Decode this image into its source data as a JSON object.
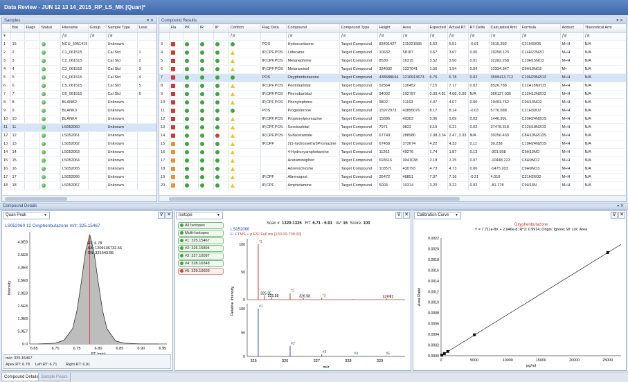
{
  "window": {
    "title": "Data Review - JUN 12 13 14_2015_RP_LS_MK [Quan]*"
  },
  "samples": {
    "title": "Samples",
    "columns": [
      "Bat",
      "Flags",
      "Status",
      "Filename",
      "Group",
      "Sample Type",
      "Leve"
    ],
    "rows": [
      {
        "n": "1",
        "bat": "15",
        "file": "NCU_5051415",
        "group": "",
        "type": "Unknown",
        "level": ""
      },
      {
        "n": "2",
        "bat": "2",
        "file": "C1_061515",
        "group": "",
        "type": "Cal Std",
        "level": "1"
      },
      {
        "n": "3",
        "bat": "3",
        "file": "C2_061515",
        "group": "",
        "type": "Cal Std",
        "level": "2"
      },
      {
        "n": "4",
        "bat": "4",
        "file": "C3_061515",
        "group": "",
        "type": "Cal Std",
        "level": "3"
      },
      {
        "n": "5",
        "bat": "5",
        "file": "C4_061515",
        "group": "",
        "type": "Cal Std",
        "level": "4"
      },
      {
        "n": "6",
        "bat": "6",
        "file": "C5_061515",
        "group": "",
        "type": "Cal Std",
        "level": "5"
      },
      {
        "n": "7",
        "bat": "7",
        "file": "C6_061515",
        "group": "",
        "type": "Cal Std",
        "level": "6"
      },
      {
        "n": "8",
        "bat": "8",
        "file": "BLANK2",
        "group": "",
        "type": "Unknown",
        "level": ""
      },
      {
        "n": "9",
        "bat": "9",
        "file": "BLANK3",
        "group": "",
        "type": "Unknown",
        "level": ""
      },
      {
        "n": "10",
        "bat": "10",
        "file": "BLANK4",
        "group": "",
        "type": "Unknown",
        "level": ""
      },
      {
        "n": "11",
        "bat": "11",
        "file": "LS052060",
        "group": "",
        "type": "Unknown",
        "level": ""
      },
      {
        "n": "12",
        "bat": "12",
        "file": "LS052061",
        "group": "",
        "type": "Unknown",
        "level": ""
      },
      {
        "n": "13",
        "bat": "13",
        "file": "LS052062",
        "group": "",
        "type": "Unknown",
        "level": ""
      },
      {
        "n": "14",
        "bat": "14",
        "file": "LS052063",
        "group": "",
        "type": "Unknown",
        "level": ""
      },
      {
        "n": "15",
        "bat": "15",
        "file": "LS052064",
        "group": "",
        "type": "Unknown",
        "level": ""
      },
      {
        "n": "16",
        "bat": "16",
        "file": "LS052065",
        "group": "",
        "type": "Unknown",
        "level": ""
      },
      {
        "n": "17",
        "bat": "17",
        "file": "LS052066",
        "group": "",
        "type": "Unknown",
        "level": ""
      },
      {
        "n": "18",
        "bat": "18",
        "file": "LS052067",
        "group": "",
        "type": "Unknown",
        "level": ""
      }
    ]
  },
  "compounds": {
    "title": "Compound Results",
    "columns": [
      "Fla",
      "PK",
      "IR",
      "IP",
      "Confirm",
      "Flag Deta",
      "Compound",
      "Compound Type",
      "Height",
      "Area",
      "Expected",
      "Actual RT",
      "RT Delta",
      "Calculated Amt",
      "Formula",
      "Adduct",
      "Theoretical Amt"
    ],
    "rows": [
      {
        "n": "3",
        "sq": "#d9342b",
        "ir": "#3aa53a",
        "conf": "dot",
        "det": "POS",
        "name": "Hydrocortisone",
        "type": "Target Compound",
        "h": "83401427",
        "a": "211021586",
        "e": "5.52",
        "rt": "5.51",
        "d": "-0.01",
        "amt": "1615.392",
        "f": "C21H30O5",
        "ad": "M+H",
        "th": "N/A"
      },
      {
        "n": "4",
        "sq": "#d9342b",
        "ir": "#3aa53a",
        "conf": "tri",
        "det": "IP,CPF,POS",
        "name": "Lidocaine",
        "type": "Target Compound",
        "h": "10632",
        "a": "58187",
        "e": "3.67",
        "rt": "3.67",
        "d": "0.00",
        "amt": "19258.123",
        "f": "C14H22N2O",
        "ad": "M+H",
        "th": "N/A"
      },
      {
        "n": "5",
        "sq": "#d9342b",
        "ir": "#3aa53a",
        "conf": "tri",
        "det": "IP,CPF,POS",
        "name": "Metanephrine",
        "type": "Target Compound",
        "h": "8530",
        "a": "16315",
        "e": "3.52",
        "rt": "3.50",
        "d": "0.01",
        "amt": "32282.268",
        "f": "C10H15NO3",
        "ad": "M+H",
        "th": "N/A"
      },
      {
        "n": "6",
        "sq": "#d9342b",
        "ir": "#3aa53a",
        "conf": "tri",
        "det": "IP,CPF,POS",
        "name": "Metaraminol",
        "type": "Target Compound",
        "h": "324032",
        "a": "1337041",
        "e": "1.50",
        "rt": "1.54",
        "d": "0.04",
        "amt": "12334.947",
        "f": "C9H13NO2",
        "ad": "M+",
        "th": "N/A"
      },
      {
        "n": "7",
        "sq": "#d9342b",
        "ir": "#3aa53a",
        "conf": "dot",
        "det": "POS",
        "name": "Oxyphenbutazone",
        "type": "Target Compound",
        "h": "438688644",
        "a": "1210913673",
        "e": "6.76",
        "rt": "6.78",
        "d": "0.02",
        "amt": "3599413.712",
        "f": "C19H20N2O3",
        "ad": "M+H",
        "th": "N/A",
        "sel": true
      },
      {
        "n": "8",
        "sq": "#d9342b",
        "ir": "#3aa53a",
        "conf": "tri",
        "det": "IP,CPF,POS",
        "name": "Pentobarbital",
        "type": "Target Compound",
        "h": "52564",
        "a": "130452",
        "e": "7.15",
        "rt": "7.17",
        "d": "0.02",
        "amt": "8526.788",
        "f": "C11H18N2O3",
        "ad": "M+H",
        "th": "N/A"
      },
      {
        "n": "9",
        "sq": "#d9342b",
        "ir": "#3aa53a",
        "conf": "tri",
        "det": "IP,CPF,POS",
        "name": "Phenobarbital",
        "type": "Target Compound",
        "h": "94002",
        "a": "292787",
        "e": "0.00,4.81",
        "rt": "4.68, 0.00",
        "d": "N/A",
        "amt": "366127.035",
        "f": "C12H12N2O3",
        "ad": "M+H",
        "th": "N/A"
      },
      {
        "n": "10",
        "sq": "#d9342b",
        "ir": "#3aa53a",
        "conf": "tri",
        "det": "IP,CPF,POS",
        "name": "Phenylephrine",
        "type": "Target Compound",
        "h": "9802",
        "a": "21163",
        "e": "4.07",
        "rt": "4.07",
        "d": "0.00",
        "amt": "19493.762",
        "f": "C9H13NO2",
        "ad": "M+H",
        "th": "N/A"
      },
      {
        "n": "11",
        "sq": "#d9342b",
        "ir": "#3aa53a",
        "conf": "dot",
        "det": "POS",
        "name": "Progesterone",
        "type": "Target Compound",
        "h": "15972973",
        "a": "43895076",
        "e": "8.17",
        "rt": "8.14",
        "d": "-0.03",
        "amt": "5776.688",
        "f": "C21H30O2",
        "ad": "M+H",
        "th": "N/A"
      },
      {
        "n": "12",
        "sq": "#d9342b",
        "ir": "#3aa53a",
        "conf": "tri",
        "det": "IP,CPF,POS",
        "name": "Propionylpromazine",
        "type": "Target Compound",
        "h": "15686",
        "a": "40303",
        "e": "5.06",
        "rt": "5.09",
        "d": "0.03",
        "amt": "1446.991",
        "f": "C20H24N2OS",
        "ad": "M+H",
        "th": "N/A"
      },
      {
        "n": "13",
        "sq": "#d9342b",
        "ir": "#3aa53a",
        "conf": "tri",
        "det": "IP,CPF,POS",
        "name": "Secobarbital",
        "type": "Target Compound",
        "h": "7971",
        "a": "9822",
        "e": "6.19",
        "rt": "6.21",
        "d": "0.02",
        "amt": "37478.318",
        "f": "C12H18N2O3",
        "ad": "M+H",
        "th": "N/A"
      },
      {
        "n": "14",
        "sq": "#d9342b",
        "ir": "#3aa53a",
        "conf": "tri",
        "det": "IP,CPF,POS",
        "name": "Sulfacetamide",
        "type": "Target Compound",
        "h": "67749",
        "a": "288980",
        "e": "2.38,3.34",
        "rt": "2.47, 3.33",
        "d": "N/A",
        "amt": "30256.433",
        "f": "C8H10N2O3S",
        "ad": "M+H",
        "th": "N/A"
      },
      {
        "n": "15",
        "sq": "#e8913a",
        "ir": "#3aa53a",
        "conf": "tri",
        "det": "IP,CPF",
        "name": "2(1-hydroxyethyl)Promazine",
        "type": "Target Compound",
        "h": "67458",
        "a": "372674",
        "e": "4.22",
        "rt": "4.33",
        "d": "0.11",
        "amt": "30.238",
        "f": "C19H24N2OS",
        "ad": "M+H",
        "th": "N/A"
      },
      {
        "n": "16",
        "sq": "#e8913a",
        "ir": "#3aa53a",
        "conf": "tri",
        "det": "",
        "name": "4-Hydroxyamphetamine",
        "type": "Target Compound",
        "h": "11262",
        "a": "49276",
        "e": "1.74",
        "rt": "1.87",
        "d": "0.13",
        "amt": "-301.958",
        "f": "C9H13NO",
        "ad": "M+H",
        "th": "N/A"
      },
      {
        "n": "17",
        "sq": "#e8913a",
        "ir": "#3aa53a",
        "conf": "tri",
        "det": "",
        "name": "Acetaminophen",
        "type": "Target Compound",
        "h": "693616",
        "a": "3041038",
        "e": "2.18",
        "rt": "2.25",
        "d": "0.07",
        "amt": "-10448.223",
        "f": "C8H9NO2",
        "ad": "M+H",
        "th": "N/A"
      },
      {
        "n": "18",
        "sq": "#e8913a",
        "ir": "#3aa53a",
        "conf": "tri",
        "det": "",
        "name": "Adrenochrome",
        "type": "Target Compound",
        "h": "103571",
        "a": "430793",
        "e": "4.73",
        "rt": "4.73",
        "d": "0.00",
        "amt": "-1475.203",
        "f": "C9H9NO3",
        "ad": "M+H",
        "th": "N/A"
      },
      {
        "n": "19",
        "sq": "#e8913a",
        "ir": "#3aa53a",
        "conf": "tri",
        "det": "IP,CPF",
        "name": "Altrenogest",
        "type": "Target Compound",
        "h": "25472",
        "a": "48851",
        "e": "7.37",
        "rt": "7.16",
        "d": "-0.21",
        "amt": "4.019",
        "f": "C21H26O2",
        "ad": "M+H",
        "th": "N/A"
      },
      {
        "n": "20",
        "sq": "#e8913a",
        "ir": "#3aa53a",
        "conf": "tri",
        "det": "IP,CPF",
        "name": "Amphetamine",
        "type": "Target Compound",
        "h": "5003",
        "a": "10314",
        "e": "3.20",
        "rt": "3.22",
        "d": "0.02",
        "amt": "-81.178",
        "f": "C9H13N",
        "ad": "M+H",
        "th": "N/A"
      }
    ]
  },
  "details": {
    "section_title": "Compound Details",
    "quan": {
      "dropdown": "Quan Peak",
      "header": "LS052060  12  Oxyphenbutazone  m/z: 325.15467",
      "ann_rt": "RT: 6.78",
      "ann_aa": "AA: 1209136732.66",
      "ann_sn": "SN: 331543.58",
      "ylabel": "Intensity",
      "xlabel": "RT (min)",
      "footer_mz": "m/z: 325.15467",
      "footer_apex": "Apex RT: 6.78",
      "footer_left": "Left RT: 6.71",
      "footer_right": "Right RT: 6.91"
    },
    "isotope": {
      "dropdown": "Isotope",
      "items": [
        "All Isotopes",
        "Multi-Isotopes",
        "#1: 325.15467",
        "#2: 326.15804",
        "#3: 327.16097",
        "#4: 328.16348",
        "#5: 329.16609"
      ],
      "scan_label": "Scan #:",
      "scan_value": "1320-1335",
      "rt_label": "RT:",
      "rt_value": "6.71 - 6.91",
      "av_label": "AV:",
      "av_value": "16",
      "score_label": "Score:",
      "score_value": "100",
      "sample": "LS052060",
      "filter_prefix": "F:",
      "filter": "FTMS + p ESI Full ms [130.00-700.00]",
      "ylabel": "Relative Intensity",
      "xlabel": "m/z",
      "top_labels": [
        "325.35",
        "325.58",
        "326.58",
        "329.22"
      ],
      "markers_top": [
        "*1",
        "*2",
        "*3",
        "*4"
      ],
      "markers_bottom": [
        "#1",
        "#2",
        "#3",
        "#4",
        "#5"
      ],
      "xticks": [
        "325",
        "326",
        "327",
        "328",
        "329"
      ]
    },
    "calibration": {
      "dropdown": "Calibration Curve",
      "title": "Oxyphenbutazone",
      "equation": "Y = 7.711e-8X + 2.946e-8; R^2: 0.9914; Origin: Ignore; W: 1/X; Area",
      "ylabel": "Area Ratio",
      "xlabel": "pg/ml"
    }
  },
  "tabs": [
    "Compound Details",
    "Sample Peaks"
  ],
  "chart_data": [
    {
      "type": "line",
      "title": "",
      "xlabel": "RT (min)",
      "ylabel": "Intensity",
      "xlim": [
        6.64,
        6.96
      ],
      "ylim": [
        0,
        440000000.0
      ],
      "xticks": [
        6.65,
        6.7,
        6.75,
        6.8,
        6.85,
        6.9,
        6.95
      ],
      "yticks": [
        0,
        50000000.0,
        100000000.0,
        150000000.0,
        200000000.0,
        250000000.0,
        300000000.0,
        350000000.0,
        400000000.0
      ],
      "ytick_labels": [
        "0.0",
        "5.0E7",
        "1.0E8",
        "1.5E8",
        "2.0E8",
        "2.5E8",
        "3.0E8",
        "3.5E8",
        "4.0E8"
      ],
      "x": [
        6.66,
        6.7,
        6.72,
        6.74,
        6.75,
        6.76,
        6.77,
        6.78,
        6.79,
        6.8,
        6.81,
        6.82,
        6.84,
        6.86,
        6.9,
        6.94
      ],
      "y": [
        0,
        3000000.0,
        15000000.0,
        60000000.0,
        130000000.0,
        240000000.0,
        360000000.0,
        430000000.0,
        360000000.0,
        240000000.0,
        130000000.0,
        60000000.0,
        12000000.0,
        3000000.0,
        0,
        0
      ],
      "marker_rt": 6.78
    },
    {
      "type": "bar",
      "title": "",
      "xlabel": "m/z",
      "ylabel": "Relative Intensity",
      "xlim": [
        324.8,
        329.8
      ],
      "ylim": [
        0,
        110
      ],
      "yticks": [
        0,
        50,
        100
      ],
      "series": [
        {
          "name": "top",
          "x": [
            325.15,
            325.35,
            325.58,
            326.16,
            326.58,
            327.16,
            328.16,
            329.22
          ],
          "y": [
            100,
            8,
            4,
            12,
            3,
            3,
            1,
            2
          ]
        },
        {
          "name": "bottom",
          "x": [
            325.15,
            326.16,
            327.16,
            328.16,
            329.17
          ],
          "y": [
            100,
            22,
            4,
            1,
            1
          ]
        }
      ]
    },
    {
      "type": "scatter",
      "title": "Oxyphenbutazone",
      "xlabel": "pg/ml",
      "ylabel": "Area Ratio",
      "xlim": [
        0,
        27000
      ],
      "ylim": [
        0,
        0.0022
      ],
      "xticks": [
        0,
        5000,
        10000,
        15000,
        20000,
        25000
      ],
      "yticks": [
        0,
        0.0002,
        0.0004,
        0.0006,
        0.0008,
        0.001,
        0.0012,
        0.0014,
        0.0016,
        0.0018,
        0.002,
        0.0022
      ],
      "x": [
        100,
        500,
        1000,
        5000,
        25000
      ],
      "y": [
        1e-05,
        4e-05,
        8e-05,
        0.00039,
        0.00193
      ],
      "fit": {
        "slope": 7.711e-08,
        "intercept": 2.946e-08
      }
    }
  ]
}
